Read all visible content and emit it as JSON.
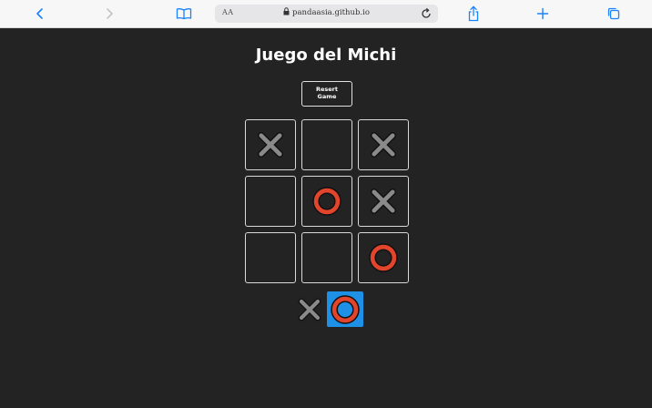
{
  "browser": {
    "aa_label": "AA",
    "url": "pandaasia.github.io",
    "icons": [
      "back-icon",
      "forward-icon",
      "bookmarks-icon",
      "lock-icon",
      "reload-icon",
      "share-icon",
      "new-tab-icon",
      "tabs-icon"
    ]
  },
  "game": {
    "title": "Juego del Michi",
    "reset_line1": "Resert",
    "reset_line2": "Game",
    "board": [
      "X",
      "",
      "X",
      "",
      "O",
      "X",
      "",
      "",
      "O"
    ],
    "turn": [
      "X",
      "O"
    ],
    "active_turn": "O"
  },
  "colors": {
    "background": "#232323",
    "x_mark": "#8a8a8a",
    "o_mark": "#e3442c",
    "active_turn": "#1e90e6",
    "toolbar_accent": "#1a82fb"
  }
}
